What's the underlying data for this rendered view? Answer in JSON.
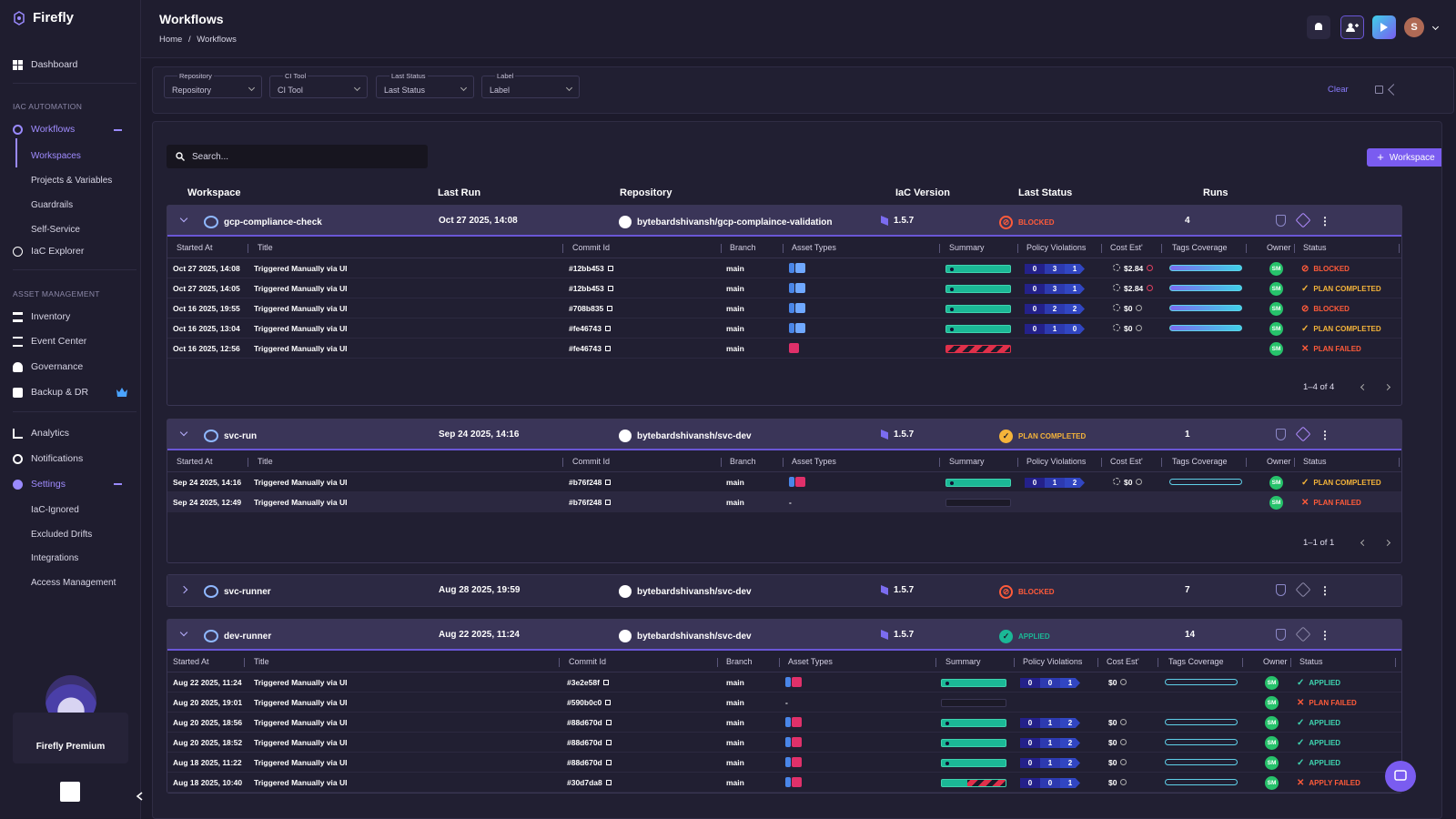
{
  "app": {
    "name": "Firefly",
    "premium_label": "Firefly Premium"
  },
  "sidebar": {
    "dashboard": "Dashboard",
    "section_iac": "IAC AUTOMATION",
    "workflows": "Workflows",
    "workflow_subs": [
      "Workspaces",
      "Projects & Variables",
      "Guardrails",
      "Self-Service"
    ],
    "iac_explorer": "IaC Explorer",
    "section_asset": "ASSET MANAGEMENT",
    "asset_items": [
      "Inventory",
      "Event Center",
      "Governance",
      "Backup & DR"
    ],
    "analytics": "Analytics",
    "notifications": "Notifications",
    "settings": "Settings",
    "settings_subs": [
      "IaC-Ignored",
      "Excluded Drifts",
      "Integrations",
      "Access Management"
    ]
  },
  "header": {
    "title": "Workflows",
    "breadcrumb_home": "Home",
    "breadcrumb_sep": "/",
    "breadcrumb_current": "Workflows",
    "avatar_letter": "S"
  },
  "filters": [
    {
      "label": "Repository",
      "value": "Repository"
    },
    {
      "label": "CI Tool",
      "value": "CI Tool"
    },
    {
      "label": "Last Status",
      "value": "Last Status"
    },
    {
      "label": "Label",
      "value": "Label"
    }
  ],
  "clear_label": "Clear",
  "search_placeholder": "Search...",
  "add_workspace_label": "Workspace",
  "columns": {
    "workspace": "Workspace",
    "last_run": "Last Run",
    "repository": "Repository",
    "iac_version": "IaC Version",
    "last_status": "Last Status",
    "runs": "Runs"
  },
  "sub_columns": {
    "started": "Started At",
    "title": "Title",
    "commit": "Commit Id",
    "branch": "Branch",
    "asset": "Asset Types",
    "summary": "Summary",
    "policy": "Policy Violations",
    "cost": "Cost Est'",
    "tags": "Tags Coverage",
    "owner": "Owner",
    "status": "Status"
  },
  "workspaces": [
    {
      "name": "gcp-compliance-check",
      "last_run": "Oct 27 2025, 14:08",
      "repo": "bytebardshivansh/gcp-complaince-validation",
      "version": "1.5.7",
      "status": "BLOCKED",
      "runs": "4",
      "pagination": "1–4 of 4",
      "rows": [
        {
          "started": "Oct 27 2025, 14:08",
          "title": "Triggered Manually via UI",
          "commit": "#12bb453",
          "branch": "main",
          "pv": [
            "0",
            "3",
            "1"
          ],
          "cost": "$2.84",
          "status": "BLOCKED"
        },
        {
          "started": "Oct 27 2025, 14:05",
          "title": "Triggered Manually via UI",
          "commit": "#12bb453",
          "branch": "main",
          "pv": [
            "0",
            "3",
            "1"
          ],
          "cost": "$2.84",
          "status": "PLAN COMPLETED"
        },
        {
          "started": "Oct 16 2025, 19:55",
          "title": "Triggered Manually via UI",
          "commit": "#708b835",
          "branch": "main",
          "pv": [
            "0",
            "2",
            "2"
          ],
          "cost": "$0",
          "status": "BLOCKED"
        },
        {
          "started": "Oct 16 2025, 13:04",
          "title": "Triggered Manually via UI",
          "commit": "#fe46743",
          "branch": "main",
          "pv": [
            "0",
            "1",
            "0"
          ],
          "cost": "$0",
          "status": "PLAN COMPLETED"
        },
        {
          "started": "Oct 16 2025, 12:56",
          "title": "Triggered Manually via UI",
          "commit": "#fe46743",
          "branch": "main",
          "pv": null,
          "cost": "",
          "status": "PLAN FAILED"
        }
      ]
    },
    {
      "name": "svc-run",
      "last_run": "Sep 24 2025, 14:16",
      "repo": "bytebardshivansh/svc-dev",
      "version": "1.5.7",
      "status": "PLAN COMPLETED",
      "runs": "1",
      "pagination": "1–1 of 1",
      "rows": [
        {
          "started": "Sep 24 2025, 14:16",
          "title": "Triggered Manually via UI",
          "commit": "#b76f248",
          "branch": "main",
          "pv": [
            "0",
            "1",
            "2"
          ],
          "cost": "$0",
          "status": "PLAN COMPLETED"
        },
        {
          "started": "Sep 24 2025, 12:49",
          "title": "Triggered Manually via UI",
          "commit": "#b76f248",
          "branch": "main",
          "asset_dash": "-",
          "pv": null,
          "cost": "",
          "status": "PLAN FAILED"
        }
      ]
    },
    {
      "name": "svc-runner",
      "last_run": "Aug 28 2025, 19:59",
      "repo": "bytebardshivansh/svc-dev",
      "version": "1.5.7",
      "status": "BLOCKED",
      "runs": "7"
    },
    {
      "name": "dev-runner",
      "last_run": "Aug 22 2025, 11:24",
      "repo": "bytebardshivansh/svc-dev",
      "version": "1.5.7",
      "status": "APPLIED",
      "runs": "14",
      "rows": [
        {
          "started": "Aug 22 2025, 11:24",
          "title": "Triggered Manually via UI",
          "commit": "#3e2e58f",
          "branch": "main",
          "pv": [
            "0",
            "0",
            "1"
          ],
          "cost": "$0",
          "status": "APPLIED"
        },
        {
          "started": "Aug 20 2025, 19:01",
          "title": "Triggered Manually via UI",
          "commit": "#590b0c0",
          "branch": "main",
          "asset_dash": "-",
          "pv": null,
          "cost": "",
          "status": "PLAN FAILED"
        },
        {
          "started": "Aug 20 2025, 18:56",
          "title": "Triggered Manually via UI",
          "commit": "#88d670d",
          "branch": "main",
          "pv": [
            "0",
            "1",
            "2"
          ],
          "cost": "$0",
          "status": "APPLIED"
        },
        {
          "started": "Aug 20 2025, 18:52",
          "title": "Triggered Manually via UI",
          "commit": "#88d670d",
          "branch": "main",
          "pv": [
            "0",
            "1",
            "2"
          ],
          "cost": "$0",
          "status": "APPLIED"
        },
        {
          "started": "Aug 18 2025, 11:22",
          "title": "Triggered Manually via UI",
          "commit": "#88d670d",
          "branch": "main",
          "pv": [
            "0",
            "1",
            "2"
          ],
          "cost": "$0",
          "status": "APPLIED"
        },
        {
          "started": "Aug 18 2025, 10:40",
          "title": "Triggered Manually via UI",
          "commit": "#30d7da8",
          "branch": "main",
          "pv": [
            "0",
            "0",
            "1"
          ],
          "cost": "$0",
          "status": "APPLY FAILED"
        }
      ]
    }
  ],
  "owner_initials": "SM",
  "colors": {
    "accent": "#7a5cf0",
    "blocked": "#ff5b3a",
    "completed": "#f5b43a",
    "applied": "#3fd4b0",
    "summary_ok": "#1bb896"
  }
}
